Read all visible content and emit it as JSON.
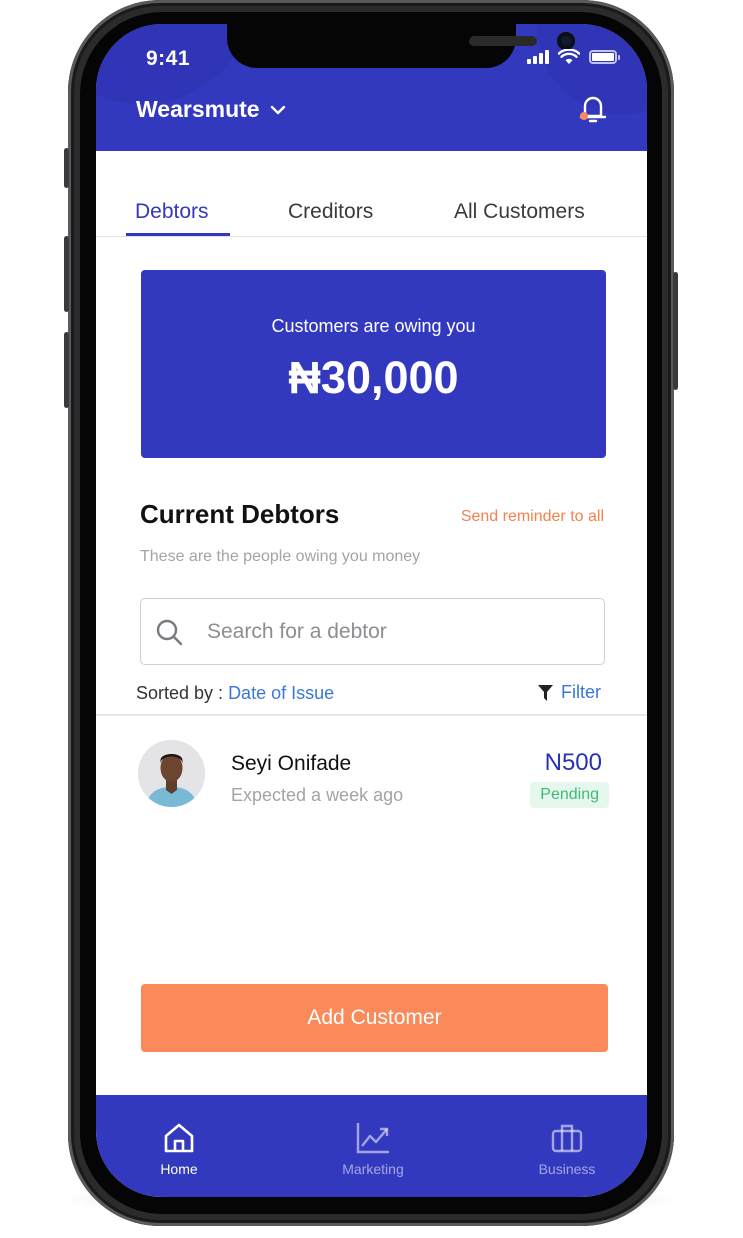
{
  "status_bar": {
    "time": "9:41"
  },
  "header": {
    "business_name": "Wearsmute",
    "icons": [
      "chevron-down-icon",
      "bell-icon"
    ]
  },
  "tabs": [
    {
      "label": "Debtors",
      "active": true
    },
    {
      "label": "Creditors",
      "active": false
    },
    {
      "label": "All Customers",
      "active": false
    }
  ],
  "summary": {
    "caption": "Customers are owing you",
    "amount": "₦30,000"
  },
  "section": {
    "title": "Current Debtors",
    "reminder_link": "Send reminder to all",
    "subtitle": "These are the people owing you money"
  },
  "search": {
    "placeholder": "Search for a debtor",
    "value": ""
  },
  "sort": {
    "label": "Sorted by : ",
    "value": "Date of Issue",
    "filter_label": "Filter"
  },
  "debtors": [
    {
      "name": "Seyi Onifade",
      "expected": "Expected a week ago",
      "amount": "N500",
      "status": "Pending"
    }
  ],
  "cta": {
    "add_customer_label": "Add Customer"
  },
  "bottom_nav": [
    {
      "label": "Home",
      "icon": "home-icon",
      "active": true
    },
    {
      "label": "Marketing",
      "icon": "chart-icon",
      "active": false
    },
    {
      "label": "Business",
      "icon": "briefcase-icon",
      "active": false
    }
  ],
  "colors": {
    "primary": "#3339bf",
    "accent": "#fa8a5a",
    "link": "#3a78d6",
    "success": "#3dbb76"
  }
}
